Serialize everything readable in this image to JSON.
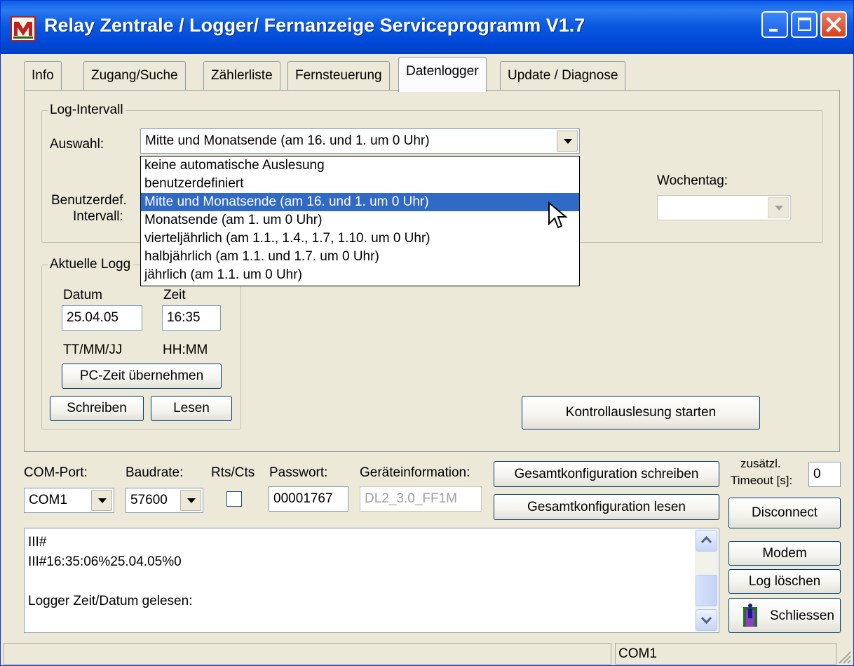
{
  "window": {
    "title": "Relay Zentrale / Logger/ Fernanzeige Serviceprogramm V1.7",
    "icon": "app-logo-icon"
  },
  "tabs": [
    {
      "label": "Info"
    },
    {
      "label": "Zugang/Suche"
    },
    {
      "label": "Zählerliste"
    },
    {
      "label": "Fernsteuerung"
    },
    {
      "label": "Datenlogger",
      "active": true
    },
    {
      "label": "Update / Diagnose"
    }
  ],
  "log_intervall": {
    "legend": "Log-Intervall",
    "auswahl_label": "Auswahl:",
    "auswahl_value": "Mitte und Monatsende (am 16. und 1. um 0 Uhr)",
    "benutzerdef_label_1": "Benutzerdef.",
    "benutzerdef_label_2": "Intervall:",
    "wochentag_label": "Wochentag:",
    "wochentag_value": "",
    "options": [
      "keine automatische Auslesung",
      "benutzerdefiniert",
      "Mitte und Monatsende (am 16. und 1. um 0 Uhr)",
      "Monatsende (am 1. um 0 Uhr)",
      "vierteljährlich (am 1.1., 1.4., 1.7, 1.10. um 0 Uhr)",
      "halbjährlich (am 1.1. und 1.7. um 0 Uhr)",
      "jährlich (am 1.1. um 0 Uhr)"
    ],
    "selected_index": 2
  },
  "logger_zeit": {
    "legend": "Aktuelle Logg",
    "datum_label": "Datum",
    "zeit_label": "Zeit",
    "datum_value": "25.04.05",
    "zeit_value": "16:35",
    "datum_format": "TT/MM/JJ",
    "zeit_format": "HH:MM",
    "pc_zeit_button": "PC-Zeit übernehmen",
    "schreiben_button": "Schreiben",
    "lesen_button": "Lesen"
  },
  "kontroll_button": "Kontrollauslesung starten",
  "connection": {
    "com_port_label": "COM-Port:",
    "com_port_value": "COM1",
    "baudrate_label": "Baudrate:",
    "baudrate_value": "57600",
    "rtscts_label": "Rts/Cts",
    "rtscts_checked": false,
    "passwort_label": "Passwort:",
    "passwort_value": "00001767",
    "geraeteinfo_label": "Geräteinformation:",
    "geraeteinfo_value": "DL2_3.0_FF1M",
    "gesamt_schreiben_button": "Gesamtkonfiguration schreiben",
    "gesamt_lesen_button": "Gesamtkonfiguration lesen",
    "timeout_label_1": "zusätzl.",
    "timeout_label_2": "Timeout [s]:",
    "timeout_value": "0",
    "disconnect_button": "Disconnect"
  },
  "log": {
    "lines": [
      "III#",
      "III#16:35:06%25.04.05%0",
      "",
      "Logger Zeit/Datum gelesen:"
    ]
  },
  "side_buttons": {
    "modem": "Modem",
    "log_loeschen": "Log löschen",
    "schliessen": "Schliessen"
  },
  "status": {
    "left": "",
    "port": "COM1"
  }
}
